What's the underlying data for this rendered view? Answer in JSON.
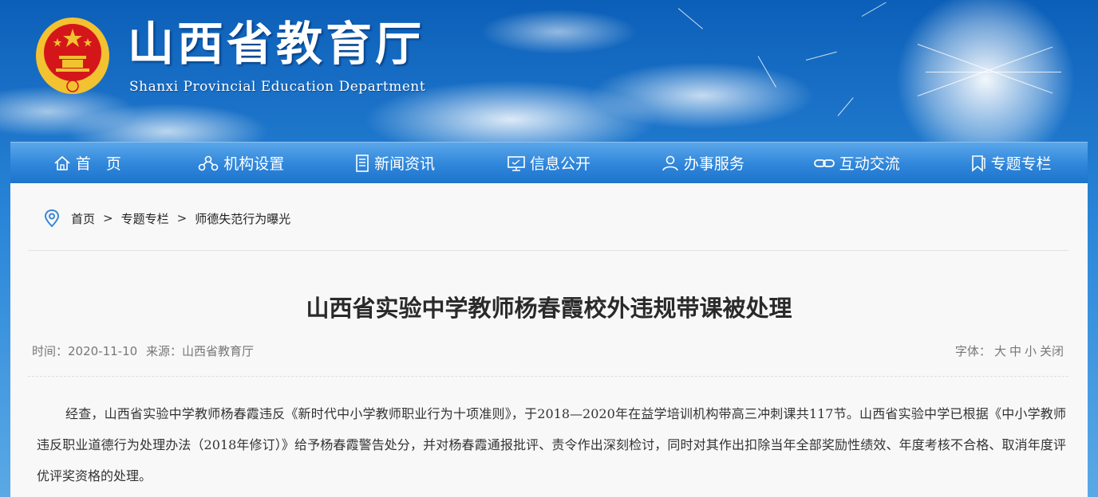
{
  "header": {
    "title": "山西省教育厅",
    "subtitle": "Shanxi Provincial Education Department"
  },
  "nav": [
    {
      "label": "首　页",
      "icon": "home-icon"
    },
    {
      "label": "机构设置",
      "icon": "org-chart-icon"
    },
    {
      "label": "新闻资讯",
      "icon": "document-icon"
    },
    {
      "label": "信息公开",
      "icon": "monitor-icon"
    },
    {
      "label": "办事服务",
      "icon": "user-icon"
    },
    {
      "label": "互动交流",
      "icon": "link-icon"
    },
    {
      "label": "专题专栏",
      "icon": "bookmark-icon"
    }
  ],
  "breadcrumb": {
    "icon": "location-pin-icon",
    "items": [
      "首页",
      "专题专栏",
      "师德失范行为曝光"
    ],
    "separator": ">"
  },
  "article": {
    "title": "山西省实验中学教师杨春霞校外违规带课被处理",
    "time_label": "时间：2020-11-10",
    "source_label": "来源：山西省教育厅",
    "font_label": "字体：",
    "font_options": [
      "大",
      "中",
      "小",
      "关闭"
    ],
    "body": "经查，山西省实验中学教师杨春霞违反《新时代中小学教师职业行为十项准则》，于2018—2020年在益学培训机构带高三冲刺课共117节。山西省实验中学已根据《中小学教师违反职业道德行为处理办法（2018年修订）》给予杨春霞警告处分，并对杨春霞通报批评、责令作出深刻检讨，同时对其作出扣除当年全部奖励性绩效、年度考核不合格、取消年度评优评奖资格的处理。"
  },
  "colors": {
    "nav_top": "#5ba6ea",
    "nav_bottom": "#1d74cc",
    "panel_bg": "#f8f8f8",
    "emblem_red": "#d4161b",
    "emblem_gold": "#f2c230"
  }
}
